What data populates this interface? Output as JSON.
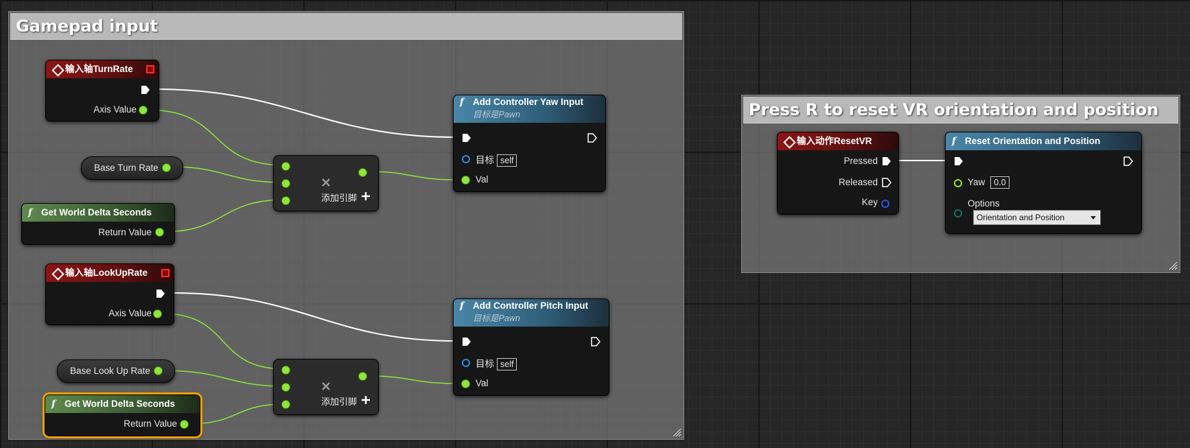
{
  "comments": [
    {
      "title": "Gamepad input"
    },
    {
      "title": "Press R to reset VR orientation and position"
    }
  ],
  "nodes": {
    "turn_event": {
      "title": "输入轴TurnRate",
      "pin_axis": "Axis Value"
    },
    "base_turn_rate": {
      "label": "Base Turn Rate"
    },
    "world_delta_1": {
      "title": "Get World Delta Seconds",
      "pin_return": "Return Value"
    },
    "multiply_1": {
      "add_pin": "添加引脚"
    },
    "yaw_input": {
      "title": "Add Controller Yaw Input",
      "subtitle": "目标是Pawn",
      "pin_target": "目标",
      "target_value": "self",
      "pin_val": "Val"
    },
    "lookup_event": {
      "title": "输入轴LookUpRate",
      "pin_axis": "Axis Value"
    },
    "base_lookup_rate": {
      "label": "Base Look Up Rate"
    },
    "world_delta_2": {
      "title": "Get World Delta Seconds",
      "pin_return": "Return Value"
    },
    "multiply_2": {
      "add_pin": "添加引脚"
    },
    "pitch_input": {
      "title": "Add Controller Pitch Input",
      "subtitle": "目标是Pawn",
      "pin_target": "目标",
      "target_value": "self",
      "pin_val": "Val"
    },
    "reset_event": {
      "title": "输入动作ResetVR",
      "pin_pressed": "Pressed",
      "pin_released": "Released",
      "pin_key": "Key"
    },
    "reset_func": {
      "title": "Reset Orientation and Position",
      "pin_yaw": "Yaw",
      "yaw_value": "0.0",
      "pin_options": "Options",
      "options_value": "Orientation and Position"
    }
  },
  "colors": {
    "event_header": "#8c1515",
    "function_header": "#4a86a8",
    "pure_header": "#5e8a4e",
    "float_pin": "#8ee63a",
    "exec_wire": "#ffffff",
    "selection": "#f0a000"
  },
  "icons": [
    "event-diamond-icon",
    "function-f-icon",
    "exec-pin-icon",
    "multiply-x-icon",
    "add-pin-plus-icon",
    "resize-grip-icon",
    "dropdown-arrow-icon"
  ]
}
